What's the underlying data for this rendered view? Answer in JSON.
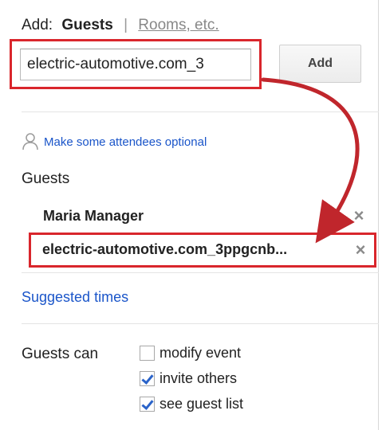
{
  "header": {
    "add_label": "Add:",
    "tab_guests": "Guests",
    "separator": "|",
    "tab_rooms": "Rooms, etc."
  },
  "guest_input": {
    "value": "electric-automotive.com_3"
  },
  "add_button": {
    "label": "Add"
  },
  "optional_link": {
    "icon": "person-icon",
    "label": "Make some attendees optional"
  },
  "guests": {
    "heading": "Guests",
    "items": [
      {
        "name": "Maria Manager",
        "remove_icon": "×"
      },
      {
        "name": "electric-automotive.com_3ppgcnb...",
        "remove_icon": "×"
      }
    ]
  },
  "suggested_times": {
    "label": "Suggested times"
  },
  "guests_can": {
    "label": "Guests can",
    "options": [
      {
        "label": "modify event",
        "checked": false
      },
      {
        "label": "invite others",
        "checked": true
      },
      {
        "label": "see guest list",
        "checked": true
      }
    ]
  },
  "colors": {
    "highlight": "#d9262c",
    "link": "#1a55c9",
    "arrow": "#c0262c"
  }
}
